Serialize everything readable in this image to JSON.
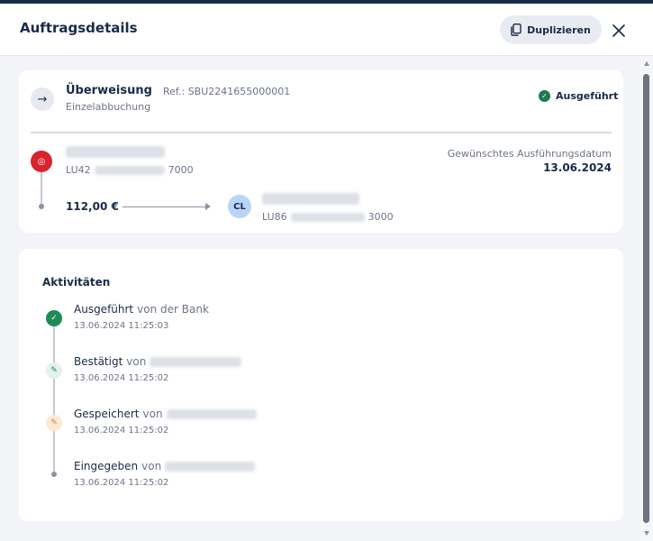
{
  "header": {
    "title": "Auftragsdetails",
    "duplicate_label": "Duplizieren",
    "icons": {
      "duplicate": "copy-icon",
      "close": "close-icon"
    }
  },
  "transaction": {
    "type": "Überweisung",
    "subtype": "Einzelabbuchung",
    "reference": "Ref.: SBU2241655000001",
    "status": "Ausgeführt",
    "status_color": "#1f7a4d",
    "sender": {
      "iban_prefix": "LU42",
      "iban_suffix": "7000"
    },
    "amount": "112,00 €",
    "receiver": {
      "initials": "CL",
      "iban_prefix": "LU86",
      "iban_suffix": "3000"
    },
    "date_label": "Gewünschtes Ausführungsdatum",
    "date_value": "13.06.2024"
  },
  "activities": {
    "title": "Aktivitäten",
    "items": [
      {
        "verb": "Ausgeführt",
        "by": "von der Bank",
        "time": "13.06.2024 11:25:03"
      },
      {
        "verb": "Bestätigt",
        "by": "von",
        "time": "13.06.2024 11:25:02"
      },
      {
        "verb": "Gespeichert",
        "by": "von",
        "time": "13.06.2024 11:25:02"
      },
      {
        "verb": "Eingegeben",
        "by": "von",
        "time": "13.06.2024 11:25:02"
      }
    ]
  }
}
